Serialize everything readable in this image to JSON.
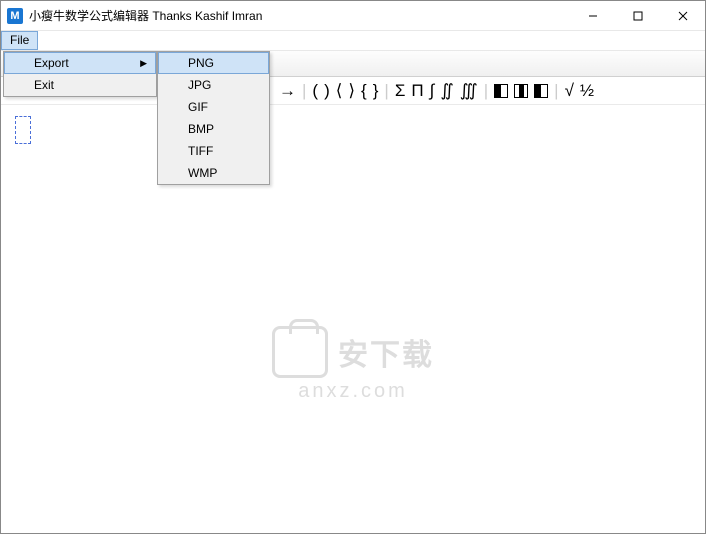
{
  "titlebar": {
    "app_letter": "M",
    "title": "小瘦牛数学公式编辑器 Thanks Kashif Imran"
  },
  "menubar": {
    "file": "File"
  },
  "file_menu": {
    "export": "Export",
    "exit": "Exit"
  },
  "export_menu": {
    "png": "PNG",
    "jpg": "JPG",
    "gif": "GIF",
    "bmp": "BMP",
    "tiff": "TIFF",
    "wmp": "WMP"
  },
  "symbols": {
    "arrow": "→",
    "lparen": "(",
    "rparen": ")",
    "langle": "⟨",
    "rangle": "⟩",
    "lbrace": "{",
    "rbrace": "}",
    "sigma": "Σ",
    "pi": "Π",
    "int": "∫",
    "dint": "∬",
    "tint": "∭",
    "sqrt": "√",
    "half": "½"
  },
  "watermark": {
    "text": "安下载",
    "sub": "anxz.com"
  }
}
